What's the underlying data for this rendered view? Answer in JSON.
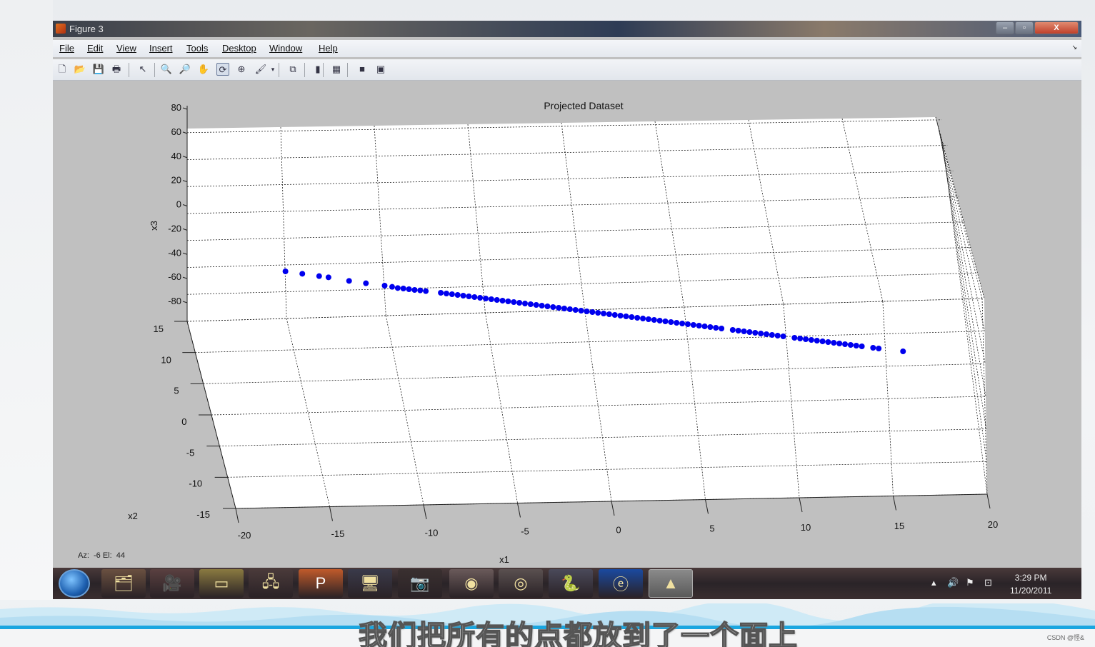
{
  "window": {
    "title": "Figure 3",
    "min_label": "–",
    "max_label": "▫",
    "close_label": "X"
  },
  "menu": [
    "File",
    "Edit",
    "View",
    "Insert",
    "Tools",
    "Desktop",
    "Window",
    "Help"
  ],
  "toolbar": {
    "icons": [
      "new-figure-icon",
      "open-file-icon",
      "save-icon",
      "print-icon",
      "edit-plot-icon",
      "zoom-in-icon",
      "zoom-out-icon",
      "pan-icon",
      "rotate-3d-icon",
      "data-cursor-icon",
      "brush-icon",
      "brush-dropdown-icon",
      "link-plot-icon",
      "colorbar-icon",
      "legend-icon",
      "hide-plot-tools-icon",
      "show-plot-tools-icon"
    ],
    "glyphs": [
      "🗋",
      "📂",
      "💾",
      "🖶",
      "↖",
      "🔍",
      "🔎",
      "✋",
      "⟳",
      "⊕",
      "🖌",
      "▾",
      "⧉",
      "▮",
      "▦",
      "■",
      "▣"
    ]
  },
  "status_text": "Az:  -6 El:  44",
  "chart_data": {
    "type": "scatter",
    "title": "Projected Dataset",
    "xlabel": "x1",
    "ylabel": "x2",
    "zlabel": "x3",
    "xlim": [
      -20,
      20
    ],
    "ylim": [
      -15,
      15
    ],
    "zlim": [
      -80,
      80
    ],
    "x_ticks": [
      "-20",
      "-15",
      "-10",
      "-5",
      "0",
      "5",
      "10",
      "15",
      "20"
    ],
    "y_ticks": [
      "15",
      "10",
      "5",
      "0",
      "-5",
      "-10",
      "-15"
    ],
    "z_ticks": [
      "80",
      "60",
      "40",
      "20",
      "0",
      "-20",
      "-40",
      "-60",
      "-80"
    ],
    "grid": true,
    "view": {
      "azimuth": -6,
      "elevation": 44
    },
    "marker_color": "#0000ee",
    "series": [
      {
        "points_x1": [
          -17.8,
          -16.9,
          -16.0,
          -15.5,
          -14.4,
          -13.5,
          -12.5,
          -12.1,
          -11.8,
          -11.5,
          -11.2,
          -10.9,
          -10.6,
          -10.3,
          -9.5,
          -9.2,
          -8.9,
          -8.6,
          -8.3,
          -8.0,
          -7.7,
          -7.4,
          -7.1,
          -6.8,
          -6.5,
          -6.2,
          -5.9,
          -5.6,
          -5.3,
          -5.0,
          -4.7,
          -4.4,
          -4.1,
          -3.8,
          -3.5,
          -3.2,
          -2.9,
          -2.6,
          -2.3,
          -2.0,
          -1.7,
          -1.4,
          -1.1,
          -0.8,
          -0.5,
          -0.2,
          0.1,
          0.4,
          0.7,
          1.0,
          1.3,
          1.6,
          1.9,
          2.2,
          2.5,
          2.8,
          3.1,
          3.4,
          3.7,
          4.0,
          4.3,
          4.6,
          4.9,
          5.2,
          5.5,
          6.1,
          6.4,
          6.7,
          7.0,
          7.3,
          7.6,
          7.9,
          8.2,
          8.5,
          8.8,
          9.4,
          9.7,
          10.0,
          10.3,
          10.6,
          10.9,
          11.2,
          11.5,
          11.8,
          12.1,
          12.4,
          12.7,
          13.0,
          13.6,
          13.9,
          15.2
        ],
        "points_x3": [
          -56,
          -57,
          -58,
          -58.5,
          -60,
          -61,
          -62,
          -62.5,
          -63,
          -63.2,
          -63.5,
          -63.8,
          -64,
          -64.3,
          -65,
          -65.3,
          -65.6,
          -65.9,
          -66.2,
          -66.5,
          -66.8,
          -67.1,
          -67.4,
          -67.7,
          -68,
          -68.3,
          -68.6,
          -68.9,
          -69.2,
          -69.5,
          -69.8,
          -70.1,
          -70.4,
          -70.7,
          -71,
          -71.3,
          -71.6,
          -71.9,
          -72.2,
          -72.5,
          -72.8,
          -73.1,
          -73.4,
          -73.7,
          -74,
          -74.3,
          -74.6,
          -74.9,
          -75.2,
          -75.5,
          -75.8,
          -76.1,
          -76.4,
          -76.7,
          -77,
          -77.3,
          -77.6,
          -77.9,
          -78.2,
          -78.5,
          -78.8,
          -79.1,
          -79.4,
          -79.7,
          -80,
          -80.6,
          -80.9,
          -81.2,
          -81.5,
          -81.8,
          -82.1,
          -82.4,
          -82.7,
          -83,
          -83.3,
          -83.9,
          -84.2,
          -84.5,
          -84.8,
          -85.1,
          -85.4,
          -85.7,
          -86,
          -86.3,
          -86.6,
          -86.9,
          -87.2,
          -87.5,
          -88.1,
          -88.4,
          -89.6
        ]
      }
    ]
  },
  "taskbar": {
    "icons": [
      {
        "name": "explorer-taskbar-icon",
        "glyph": "🗂"
      },
      {
        "name": "media-taskbar-icon",
        "glyph": "🎥"
      },
      {
        "name": "sticky-notes-taskbar-icon",
        "glyph": "▭"
      },
      {
        "name": "network-taskbar-icon",
        "glyph": "🖧"
      },
      {
        "name": "powerpoint-taskbar-icon",
        "glyph": "P"
      },
      {
        "name": "remote-desktop-taskbar-icon",
        "glyph": "🖥"
      },
      {
        "name": "camera-taskbar-icon",
        "glyph": "📷"
      },
      {
        "name": "chrome-taskbar-icon",
        "glyph": "◉"
      },
      {
        "name": "webcam-taskbar-icon",
        "glyph": "◎"
      },
      {
        "name": "python-taskbar-icon",
        "glyph": "🐍"
      },
      {
        "name": "browser-taskbar-icon",
        "glyph": "ⓔ"
      },
      {
        "name": "matlab-taskbar-icon",
        "glyph": "▲"
      }
    ],
    "clock_time": "3:29 PM",
    "clock_date": "11/20/2011"
  },
  "subtitle": "我们把所有的点都放到了一个面上",
  "watermark": "CSDN @怪&"
}
